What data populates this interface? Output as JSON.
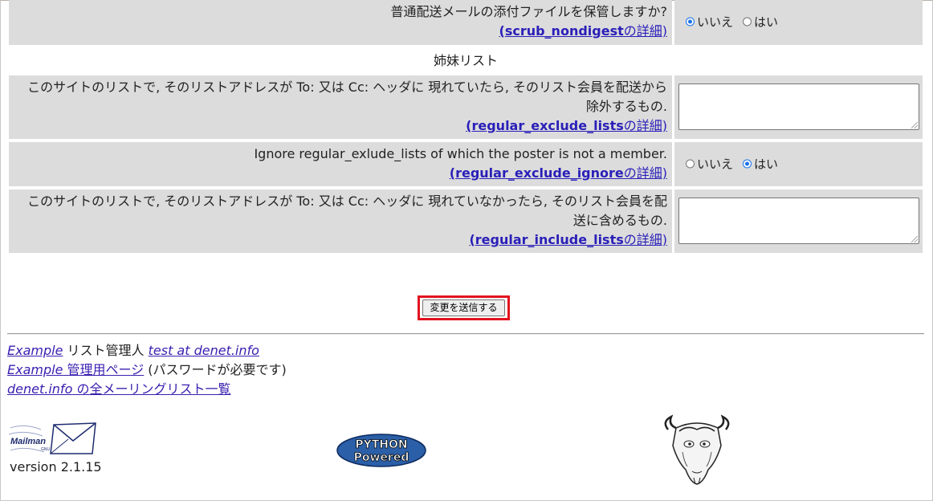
{
  "rows": {
    "scrub": {
      "question": "普通配送メールの添付ファイルを保管しますか?",
      "detail_open": "(",
      "detail_var": "scrub_nondigest",
      "detail_tail": "の詳細)",
      "options": [
        "いいえ",
        "はい"
      ],
      "selected": "いいえ"
    },
    "section_title": "姉妹リスト",
    "regular_exclude_lists": {
      "line1": "このサイトのリストで, そのリストアドレスが To: 又は Cc: ヘッダに 現れていたら, そのリスト会員を配送から",
      "line2": "除外するもの.",
      "detail_open": "(",
      "detail_var": "regular_exclude_lists",
      "detail_tail": "の詳細)",
      "value": ""
    },
    "regular_exclude_ignore": {
      "question": "Ignore regular_exlude_lists of which the poster is not a member.",
      "detail_open": "(",
      "detail_var": "regular_exclude_ignore",
      "detail_tail": "の詳細)",
      "options": [
        "いいえ",
        "はい"
      ],
      "selected": "はい"
    },
    "regular_include_lists": {
      "line1": "このサイトのリストで, そのリストアドレスが To: 又は Cc: ヘッダに 現れていなかったら, そのリスト会員を配",
      "line2": "送に含めるもの.",
      "detail_open": "(",
      "detail_var": "regular_include_lists",
      "detail_tail": "の詳細)",
      "value": ""
    }
  },
  "submit_label": "変更を送信する",
  "footer": {
    "list_name": "Example",
    "admin_text": " リスト管理人 ",
    "admin_email": "test at denet.info",
    "admin_page_list": "Example",
    "admin_page_link": " 管理用ページ",
    "admin_page_note": " (パスワードが必要です)",
    "all_lists_domain": "denet.info",
    "all_lists_text": " の全メーリングリスト一覧"
  },
  "logos": {
    "mailman_text": "Mailman",
    "mailman_small": "GNU",
    "version": "version 2.1.15",
    "python_line1": "PYTHON",
    "python_line2": "Powered"
  },
  "colors": {
    "cell_bg": "#dcdcdc",
    "link": "#2a1fb8",
    "highlight": "#e0141e",
    "radio_on": "#1a73e8"
  }
}
